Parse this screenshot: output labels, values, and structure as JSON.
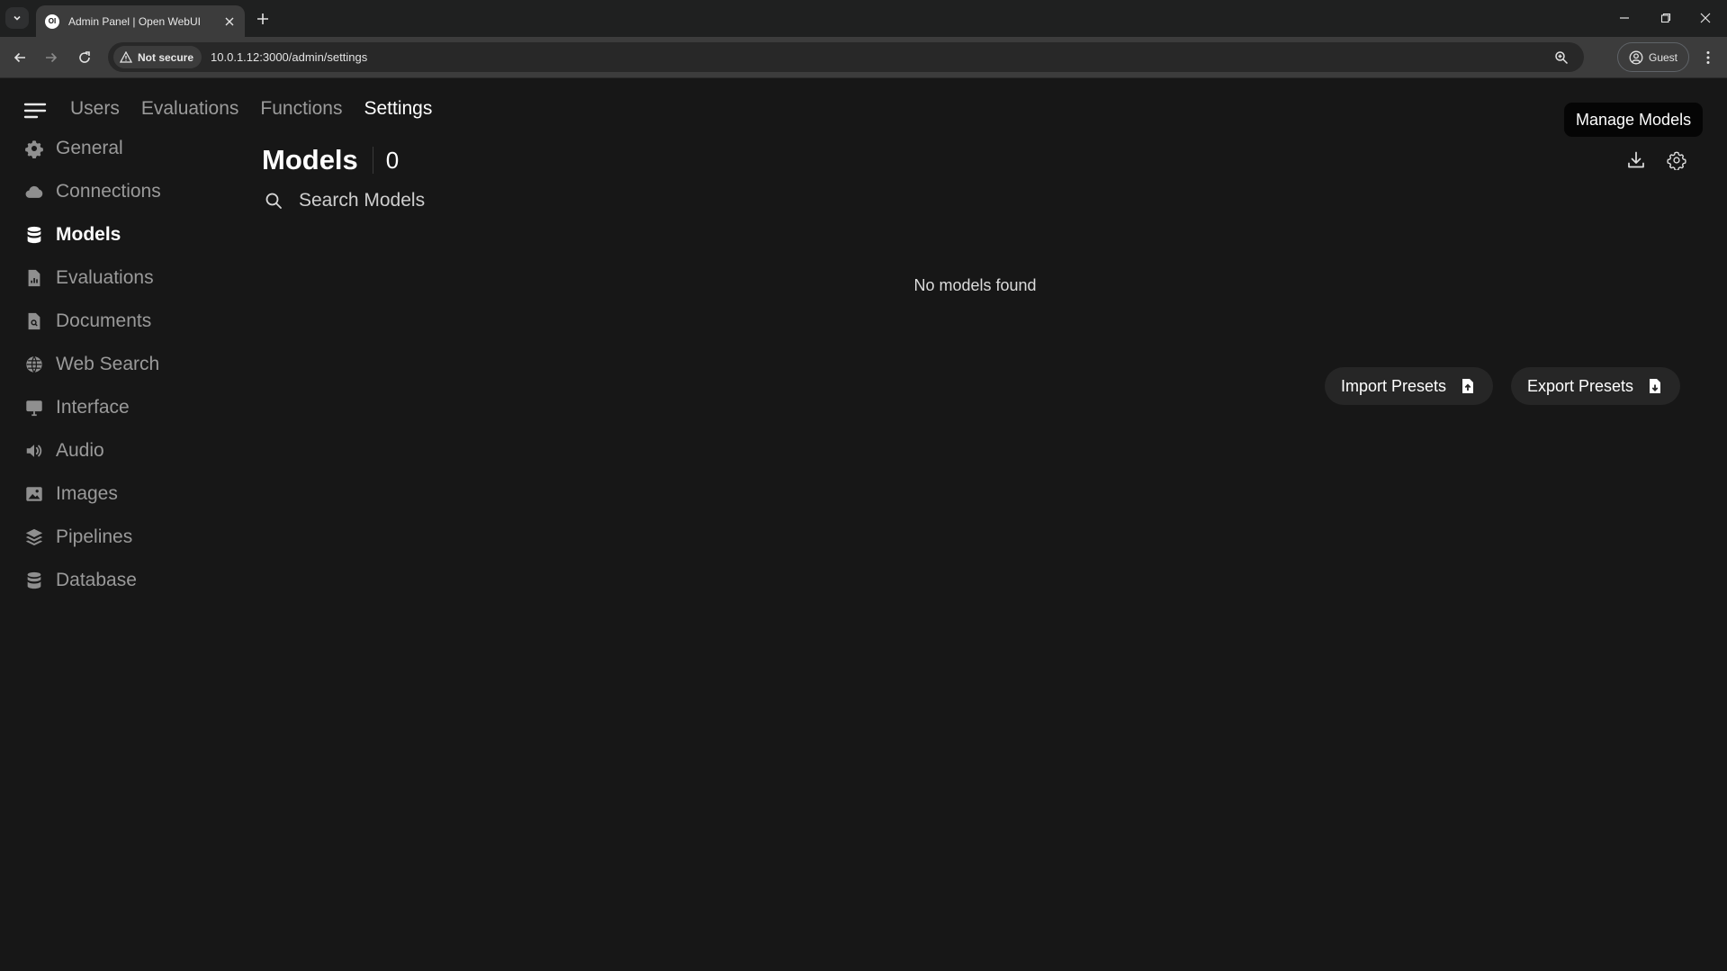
{
  "browser": {
    "tab_title": "Admin Panel | Open WebUI",
    "favicon_text": "OI",
    "security_label": "Not secure",
    "url": "10.0.1.12:3000/admin/settings",
    "profile_label": "Guest"
  },
  "app": {
    "top_tabs": [
      {
        "label": "Users",
        "active": false
      },
      {
        "label": "Evaluations",
        "active": false
      },
      {
        "label": "Functions",
        "active": false
      },
      {
        "label": "Settings",
        "active": true
      }
    ],
    "sidebar": {
      "items": [
        {
          "label": "General",
          "icon": "gear-icon",
          "active": false
        },
        {
          "label": "Connections",
          "icon": "cloud-icon",
          "active": false
        },
        {
          "label": "Models",
          "icon": "database-icon",
          "active": true
        },
        {
          "label": "Evaluations",
          "icon": "document-chart-icon",
          "active": false
        },
        {
          "label": "Documents",
          "icon": "document-search-icon",
          "active": false
        },
        {
          "label": "Web Search",
          "icon": "globe-icon",
          "active": false
        },
        {
          "label": "Interface",
          "icon": "monitor-icon",
          "active": false
        },
        {
          "label": "Audio",
          "icon": "speaker-icon",
          "active": false
        },
        {
          "label": "Images",
          "icon": "image-icon",
          "active": false
        },
        {
          "label": "Pipelines",
          "icon": "layers-icon",
          "active": false
        },
        {
          "label": "Database",
          "icon": "database-icon",
          "active": false
        }
      ]
    },
    "models": {
      "title": "Models",
      "count": "0",
      "search_placeholder": "Search Models",
      "empty_message": "No models found",
      "tooltip": "Manage Models",
      "import_label": "Import Presets",
      "export_label": "Export Presets"
    },
    "colors": {
      "background": "#171717",
      "browser_toolbar": "#3c3c3c",
      "button_bg": "#262626",
      "tooltip_bg": "#050505"
    }
  }
}
